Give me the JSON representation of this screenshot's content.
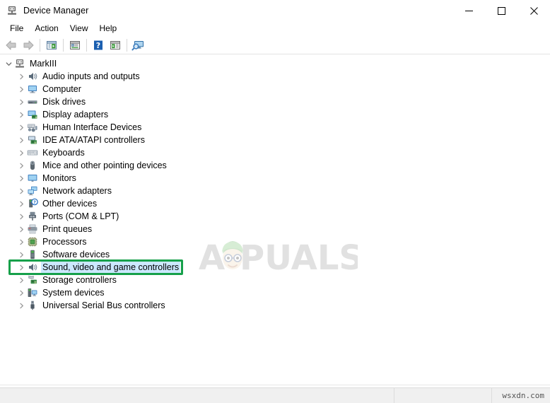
{
  "window": {
    "title": "Device Manager",
    "icon": "device-manager-icon",
    "controls": {
      "minimize": "minimize-icon",
      "maximize": "maximize-icon",
      "close": "close-icon"
    }
  },
  "menubar": {
    "items": [
      {
        "label": "File"
      },
      {
        "label": "Action"
      },
      {
        "label": "View"
      },
      {
        "label": "Help"
      }
    ]
  },
  "toolbar": {
    "buttons": [
      {
        "name": "back-arrow-icon",
        "tip": "Back"
      },
      {
        "name": "forward-arrow-icon",
        "tip": "Forward"
      },
      {
        "name": "show-hide-console-tree-icon",
        "tip": "Show/Hide Console Tree"
      },
      {
        "name": "properties-icon",
        "tip": "Properties"
      },
      {
        "name": "help-icon",
        "tip": "Help"
      },
      {
        "name": "update-driver-icon",
        "tip": "Update Driver Software"
      },
      {
        "name": "scan-hardware-changes-icon",
        "tip": "Scan for hardware changes"
      }
    ]
  },
  "tree": {
    "root": {
      "label": "MarkIII",
      "icon": "computer-root-icon",
      "expanded": true,
      "chevron": "chevron-down-icon"
    },
    "items": [
      {
        "label": "Audio inputs and outputs",
        "icon": "speaker-icon",
        "chevron": "chevron-right-icon",
        "selected": false
      },
      {
        "label": "Computer",
        "icon": "monitor-icon",
        "chevron": "chevron-right-icon",
        "selected": false
      },
      {
        "label": "Disk drives",
        "icon": "disk-drive-icon",
        "chevron": "chevron-right-icon",
        "selected": false
      },
      {
        "label": "Display adapters",
        "icon": "display-adapter-icon",
        "chevron": "chevron-right-icon",
        "selected": false
      },
      {
        "label": "Human Interface Devices",
        "icon": "hid-icon",
        "chevron": "chevron-right-icon",
        "selected": false
      },
      {
        "label": "IDE ATA/ATAPI controllers",
        "icon": "ide-controller-icon",
        "chevron": "chevron-right-icon",
        "selected": false
      },
      {
        "label": "Keyboards",
        "icon": "keyboard-icon",
        "chevron": "chevron-right-icon",
        "selected": false
      },
      {
        "label": "Mice and other pointing devices",
        "icon": "mouse-icon",
        "chevron": "chevron-right-icon",
        "selected": false
      },
      {
        "label": "Monitors",
        "icon": "monitor-icon",
        "chevron": "chevron-right-icon",
        "selected": false
      },
      {
        "label": "Network adapters",
        "icon": "network-adapter-icon",
        "chevron": "chevron-right-icon",
        "selected": false
      },
      {
        "label": "Other devices",
        "icon": "other-devices-icon",
        "chevron": "chevron-right-icon",
        "selected": false
      },
      {
        "label": "Ports (COM & LPT)",
        "icon": "port-icon",
        "chevron": "chevron-right-icon",
        "selected": false
      },
      {
        "label": "Print queues",
        "icon": "printer-icon",
        "chevron": "chevron-right-icon",
        "selected": false
      },
      {
        "label": "Processors",
        "icon": "processor-icon",
        "chevron": "chevron-right-icon",
        "selected": false
      },
      {
        "label": "Software devices",
        "icon": "software-device-icon",
        "chevron": "chevron-right-icon",
        "selected": false
      },
      {
        "label": "Sound, video and game controllers",
        "icon": "speaker-icon",
        "chevron": "chevron-right-icon",
        "selected": true
      },
      {
        "label": "Storage controllers",
        "icon": "storage-controller-icon",
        "chevron": "chevron-right-icon",
        "selected": false
      },
      {
        "label": "System devices",
        "icon": "system-device-icon",
        "chevron": "chevron-right-icon",
        "selected": false
      },
      {
        "label": "Universal Serial Bus controllers",
        "icon": "usb-icon",
        "chevron": "chevron-right-icon",
        "selected": false
      }
    ]
  },
  "annotation": {
    "highlight_color": "#16a04a",
    "highlight_target": "Sound, video and game controllers"
  },
  "watermark": {
    "brand": "PUALS",
    "brand_prefix": "A",
    "mascot": "appuals-mascot-icon"
  },
  "statusbar": {
    "main": "",
    "mid": "",
    "right": "wsxdn.com"
  },
  "colors": {
    "selection": "#cce8ff",
    "accent_green": "#16a04a",
    "titlebar_bg": "#ffffff",
    "statusbar_bg": "#f0f0f0"
  }
}
